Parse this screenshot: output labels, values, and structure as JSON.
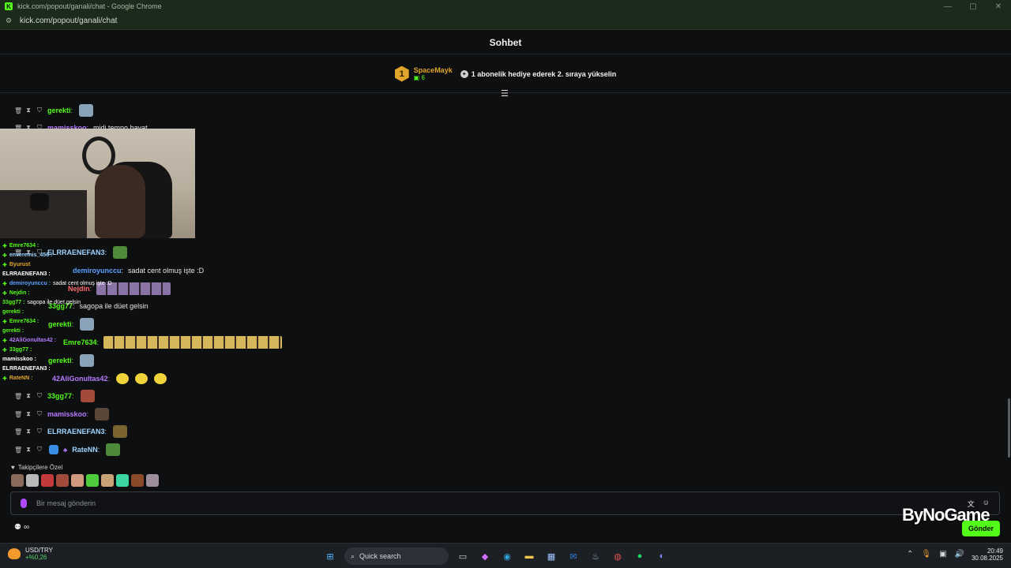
{
  "window": {
    "title": "kick.com/popout/ganali/chat - Google Chrome",
    "url": "kick.com/popout/ganali/chat",
    "controls": [
      "—",
      "▢",
      "✕"
    ]
  },
  "chat": {
    "header_title": "Sohbet",
    "pinned": {
      "rank": "1",
      "name": "SpaceMayk",
      "count": "6",
      "message": "1 abonelik hediye ederek 2. sıraya yükselin"
    },
    "messages": [
      {
        "user": "gerekti",
        "color": "#53fc18",
        "text": ""
      },
      {
        "user": "mamisskoo",
        "color": "#b57bff",
        "text": "midi tempo hayat"
      },
      {
        "user": "ELRRAENEFAN3",
        "color": "#9fd4ff",
        "text": ""
      },
      {
        "user": "demiroyunccu",
        "color": "#5aa0ff",
        "text": "sadat cent olmuş işte :D"
      },
      {
        "user": "Nejdin",
        "color": "#ff6b6b",
        "text": ""
      },
      {
        "user": "33gg77",
        "color": "#53fc18",
        "text": "sagopa ile düet gelsin"
      },
      {
        "user": "gerekti",
        "color": "#53fc18",
        "text": ""
      },
      {
        "user": "Emre7634",
        "color": "#53fc18",
        "text": ""
      },
      {
        "user": "gerekti",
        "color": "#53fc18",
        "text": ""
      },
      {
        "user": "42AliGonultas42",
        "color": "#b57bff",
        "text": ""
      },
      {
        "user": "33gg77",
        "color": "#53fc18",
        "text": ""
      },
      {
        "user": "mamisskoo",
        "color": "#b57bff",
        "text": ""
      },
      {
        "user": "ELRRAENEFAN3",
        "color": "#9fd4ff",
        "text": ""
      },
      {
        "user": "RateNN",
        "color": "#9fd4ff",
        "text": ""
      }
    ],
    "overlay_chat": [
      {
        "user": "Emre7634 :",
        "color": "#53fc18",
        "text": ""
      },
      {
        "user": "enveremis_456 :",
        "color": "#9fd4ff",
        "text": ""
      },
      {
        "user": "Byurust",
        "color": "#e2a52b",
        "text": ""
      },
      {
        "user": "ELRRAENEFAN3 :",
        "color": "#ffffff",
        "text": ""
      },
      {
        "user": "demiroyunccu :",
        "color": "#5aa0ff",
        "text": "sadat cent olmuş işte :D"
      },
      {
        "user": "Nejdin :",
        "color": "#53fc18",
        "text": ""
      },
      {
        "user": "33gg77 :",
        "color": "#53fc18",
        "text": "sagopa ile düet gelsin"
      },
      {
        "user": "gerekti :",
        "color": "#53fc18",
        "text": ""
      },
      {
        "user": "Emre7634 :",
        "color": "#53fc18",
        "text": ""
      },
      {
        "user": "gerekti :",
        "color": "#53fc18",
        "text": ""
      },
      {
        "user": "42AliGonultas42 :",
        "color": "#b57bff",
        "text": ""
      },
      {
        "user": "33gg77 :",
        "color": "#53fc18",
        "text": ""
      },
      {
        "user": "mamisskoo :",
        "color": "#ffffff",
        "text": ""
      },
      {
        "user": "ELRRAENEFAN3 :",
        "color": "#ffffff",
        "text": ""
      },
      {
        "user": "RateNN :",
        "color": "#e2a52b",
        "text": ""
      }
    ],
    "followers_label": "Takipçilere Özel",
    "input_placeholder": "Bir mesaj gönderin",
    "points_label": "∞",
    "send_label": "Gönder",
    "watermark": "ByNoGame"
  },
  "taskbar": {
    "ticker_name": "USD/TRY",
    "ticker_change": "+%0,26",
    "search_placeholder": "Quick search",
    "time": "20:49",
    "date": "30.08.2025"
  },
  "colors": {
    "kick_green": "#53fc18",
    "gold": "#e2a52b",
    "background": "#0e0f11"
  }
}
